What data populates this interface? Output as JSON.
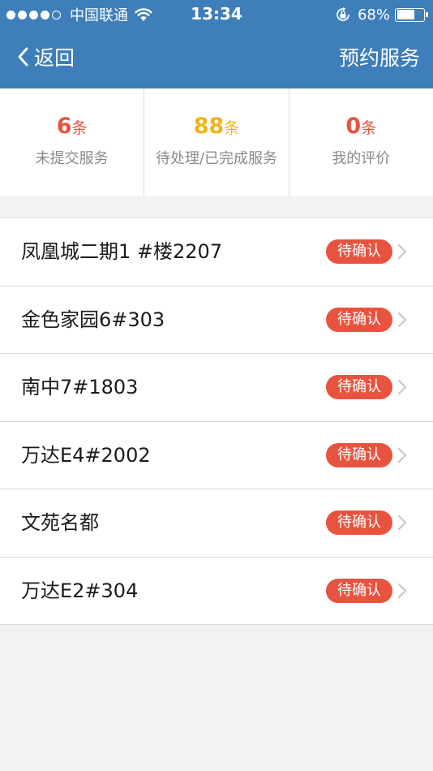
{
  "status_bar": {
    "carrier": "中国联通",
    "time": "13:34",
    "battery_percent": "68%",
    "battery_level": 0.68,
    "signal_bars": 4,
    "icons": [
      "signal-dots-icon",
      "wifi-icon",
      "orientation-lock-icon",
      "battery-icon"
    ]
  },
  "nav": {
    "back_label": "返回",
    "action_label": "预约服务",
    "background_color": "#3d7ebb"
  },
  "stats": [
    {
      "number": "6",
      "unit": "条",
      "label": "未提交服务",
      "color": "#e8533f"
    },
    {
      "number": "88",
      "unit": "条",
      "label": "待处理/已完成服务",
      "color": "#f0b416"
    },
    {
      "number": "0",
      "unit": "条",
      "label": "我的评价",
      "color": "#e8533f"
    }
  ],
  "list": {
    "items": [
      {
        "title": "凤凰城二期1 #楼2207",
        "status": "待确认"
      },
      {
        "title": "金色家园6#303",
        "status": "待确认"
      },
      {
        "title": "南中7#1803",
        "status": "待确认"
      },
      {
        "title": "万达E4#2002",
        "status": "待确认"
      },
      {
        "title": "文苑名都",
        "status": "待确认"
      },
      {
        "title": "万达E2#304",
        "status": "待确认"
      }
    ],
    "badge_color": "#e8533f"
  }
}
